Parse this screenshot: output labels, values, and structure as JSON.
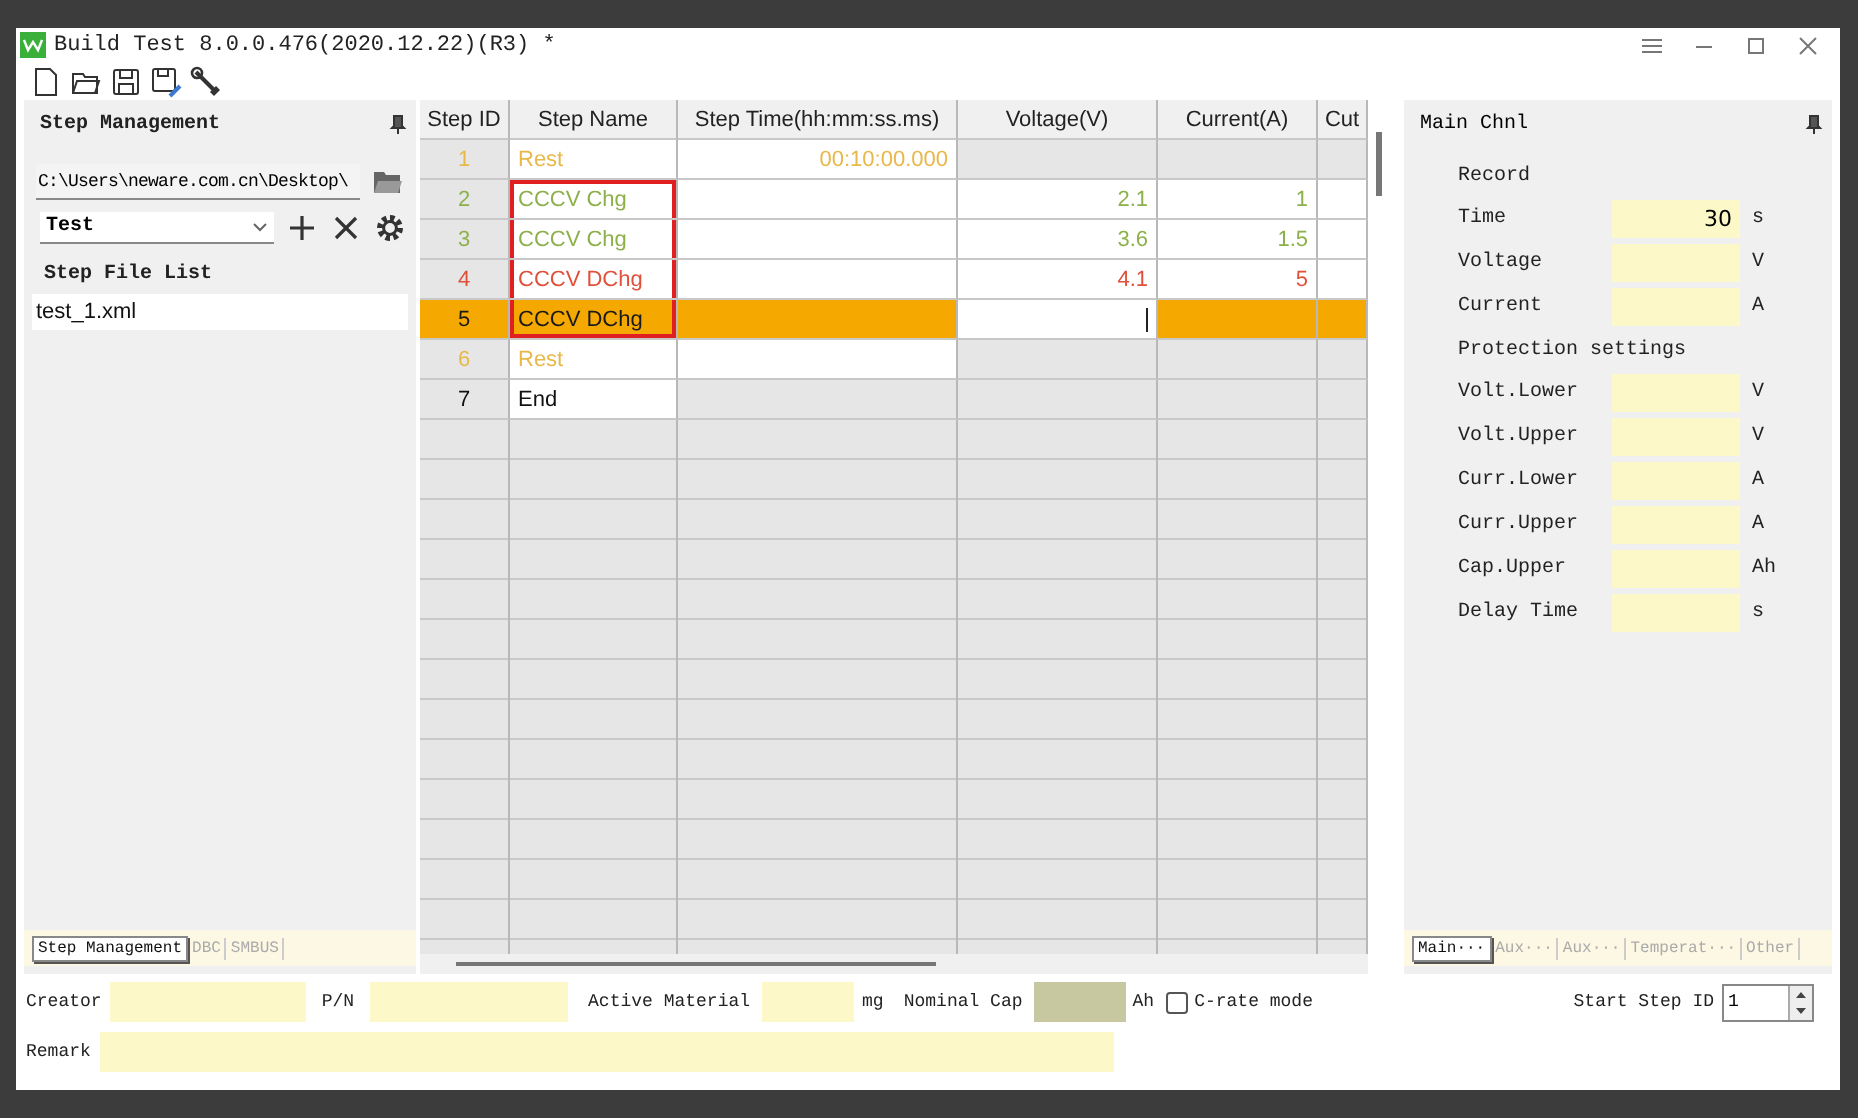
{
  "window": {
    "title": "Build Test 8.0.0.476(2020.12.22)(R3) *"
  },
  "left_panel": {
    "title": "Step Management",
    "path": "C:\\Users\\neware.com.cn\\Desktop\\",
    "profile": "Test",
    "list_title": "Step File List",
    "files": [
      {
        "name": "test_1.xml",
        "selected": true
      }
    ],
    "tabs": [
      {
        "label": "Step Management",
        "selected": true
      },
      {
        "label": "DBC",
        "selected": false
      },
      {
        "label": "SMBUS",
        "selected": false
      }
    ]
  },
  "table": {
    "columns": [
      "Step ID",
      "Step Name",
      "Step Time(hh:mm:ss.ms)",
      "Voltage(V)",
      "Current(A)",
      "Cut"
    ],
    "rows": [
      {
        "id": "1",
        "name": "Rest",
        "time": "00:10:00.000",
        "kind": "rest",
        "selected": false,
        "highlighted": false
      },
      {
        "id": "2",
        "name": "CCCV Chg",
        "voltage": "2.1",
        "current": "1",
        "kind": "charge",
        "selected": false,
        "highlighted": true
      },
      {
        "id": "3",
        "name": "CCCV Chg",
        "voltage": "3.6",
        "current": "1.5",
        "kind": "charge",
        "selected": false,
        "highlighted": true
      },
      {
        "id": "4",
        "name": "CCCV DChg",
        "voltage": "4.1",
        "current": "5",
        "kind": "discharge",
        "selected": false,
        "highlighted": true
      },
      {
        "id": "5",
        "name": "CCCV DChg",
        "kind": "discharge",
        "selected": true,
        "voltage_editing": true,
        "highlighted": true
      },
      {
        "id": "6",
        "name": "Rest",
        "kind": "rest",
        "selected": false,
        "highlighted": false
      },
      {
        "id": "7",
        "name": "End",
        "kind": "end",
        "selected": false,
        "highlighted": false
      }
    ]
  },
  "right_panel": {
    "title": "Main Chnl",
    "items": [
      {
        "kind": "section",
        "label": "Record"
      },
      {
        "kind": "field",
        "label": "Time",
        "value": "30",
        "unit": "s"
      },
      {
        "kind": "field",
        "label": "Voltage",
        "unit": "V"
      },
      {
        "kind": "field",
        "label": "Current",
        "unit": "A"
      },
      {
        "kind": "section",
        "label": "Protection settings"
      },
      {
        "kind": "field",
        "label": "Volt.Lower",
        "unit": "V"
      },
      {
        "kind": "field",
        "label": "Volt.Upper",
        "unit": "V"
      },
      {
        "kind": "field",
        "label": "Curr.Lower",
        "unit": "A"
      },
      {
        "kind": "field",
        "label": "Curr.Upper",
        "unit": "A"
      },
      {
        "kind": "field",
        "label": "Cap.Upper",
        "unit": "Ah"
      },
      {
        "kind": "field",
        "label": "Delay Time",
        "unit": "s"
      }
    ],
    "tabs": [
      {
        "label": "Main···",
        "selected": true
      },
      {
        "label": "Aux···",
        "selected": false
      },
      {
        "label": "Aux···",
        "selected": false
      },
      {
        "label": "Temperat···",
        "selected": false
      },
      {
        "label": "Other",
        "selected": false
      }
    ]
  },
  "bottom": {
    "creator_label": "Creator",
    "pn_label": "P/N",
    "material_label": "Active Material",
    "material_unit": "mg",
    "capacity_label": "Nominal Cap",
    "capacity_unit": "Ah",
    "capacity_disabled": true,
    "crate_label": "C-rate mode",
    "crate_checked": false,
    "start_label": "Start Step ID",
    "start_value": "1",
    "remark_label": "Remark"
  }
}
